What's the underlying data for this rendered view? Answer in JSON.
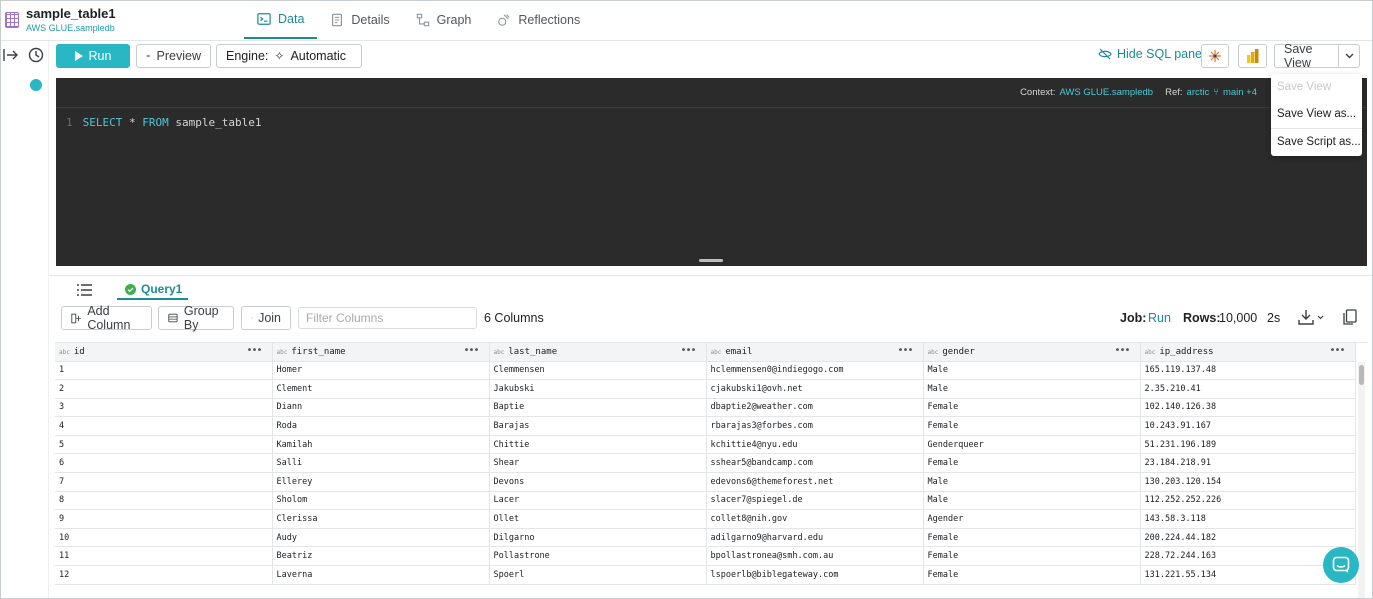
{
  "header": {
    "title": "sample_table1",
    "subtitle": "AWS GLUE.sampledb",
    "tabs": [
      {
        "label": "Data",
        "active": true
      },
      {
        "label": "Details",
        "active": false
      },
      {
        "label": "Graph",
        "active": false
      },
      {
        "label": "Reflections",
        "active": false
      }
    ]
  },
  "toolbar": {
    "run_label": "Run",
    "preview_label": "Preview",
    "engine_label": "Engine:",
    "engine_value": "Automatic",
    "hide_sql_label": "Hide SQL pane",
    "save_view_label": "Save View"
  },
  "save_menu": {
    "items": [
      {
        "label": "Save View",
        "disabled": true
      },
      {
        "label": "Save View as...",
        "disabled": false
      },
      {
        "label": "Save Script as...",
        "disabled": false
      }
    ]
  },
  "editor": {
    "context_label": "Context:",
    "context_value": "AWS GLUE.sampledb",
    "ref_label": "Ref:",
    "ref_value": "arctic",
    "branch_value": "main +4",
    "line_number": "1",
    "sql_keyword_1": "SELECT",
    "sql_star": "*",
    "sql_keyword_2": "FROM",
    "sql_table": "sample_table1"
  },
  "results": {
    "query_tab": "Query1",
    "add_column": "Add Column",
    "group_by": "Group By",
    "join": "Join",
    "filter_placeholder": "Filter Columns",
    "columns_count": "6 Columns",
    "job_label": "Job:",
    "job_value": "Run",
    "rows_label": "Rows:",
    "rows_value": "10,000",
    "duration": "2s",
    "type_badge": "abc",
    "column_headers": [
      "id",
      "first_name",
      "last_name",
      "email",
      "gender",
      "ip_address"
    ],
    "rows": [
      [
        "1",
        "Homer",
        "Clemmensen",
        "hclemmensen0@indiegogo.com",
        "Male",
        "165.119.137.48"
      ],
      [
        "2",
        "Clement",
        "Jakubski",
        "cjakubski1@ovh.net",
        "Male",
        "2.35.210.41"
      ],
      [
        "3",
        "Diann",
        "Baptie",
        "dbaptie2@weather.com",
        "Female",
        "102.140.126.38"
      ],
      [
        "4",
        "Roda",
        "Barajas",
        "rbarajas3@forbes.com",
        "Female",
        "10.243.91.167"
      ],
      [
        "5",
        "Kamilah",
        "Chittie",
        "kchittie4@nyu.edu",
        "Genderqueer",
        "51.231.196.189"
      ],
      [
        "6",
        "Salli",
        "Shear",
        "sshear5@bandcamp.com",
        "Female",
        "23.184.218.91"
      ],
      [
        "7",
        "Ellerey",
        "Devons",
        "edevons6@themeforest.net",
        "Male",
        "130.203.120.154"
      ],
      [
        "8",
        "Sholom",
        "Lacer",
        "slacer7@spiegel.de",
        "Male",
        "112.252.252.226"
      ],
      [
        "9",
        "Clerissa",
        "Ollet",
        "collet8@nih.gov",
        "Agender",
        "143.58.3.118"
      ],
      [
        "10",
        "Audy",
        "Dilgarno",
        "adilgarno9@harvard.edu",
        "Female",
        "200.224.44.182"
      ],
      [
        "11",
        "Beatriz",
        "Pollastrone",
        "bpollastronea@smh.com.au",
        "Female",
        "228.72.244.163"
      ],
      [
        "12",
        "Laverna",
        "Spoerl",
        "lspoerlb@biblegateway.com",
        "Female",
        "131.221.55.134"
      ]
    ]
  },
  "colors": {
    "accent": "#2ab7c4",
    "accent_dark": "#1d8b97",
    "editor_bg": "#2b2b2b"
  }
}
